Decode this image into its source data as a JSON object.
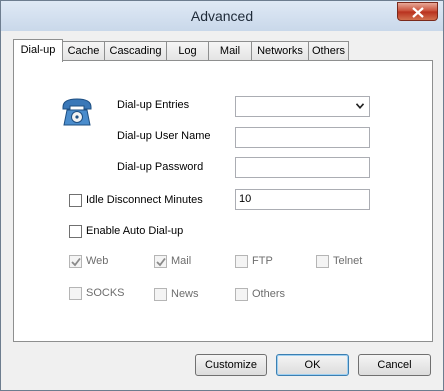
{
  "window": {
    "title": "Advanced"
  },
  "tabs": [
    {
      "label": "Dial-up",
      "active": true
    },
    {
      "label": "Cache",
      "active": false
    },
    {
      "label": "Cascading",
      "active": false
    },
    {
      "label": "Log",
      "active": false
    },
    {
      "label": "Mail",
      "active": false
    },
    {
      "label": "Networks",
      "active": false
    },
    {
      "label": "Others",
      "active": false
    }
  ],
  "form": {
    "phone_icon": "telephone-icon",
    "dialup_entries_label": "Dial-up Entries",
    "dialup_entries_value": "",
    "user_name_label": "Dial-up User Name",
    "user_name_value": "",
    "password_label": "Dial-up Password",
    "password_value": "",
    "idle_disconnect_label": "Idle Disconnect Minutes",
    "idle_disconnect_checked": false,
    "idle_disconnect_value": "10",
    "auto_dialup_label": "Enable Auto Dial-up",
    "auto_dialup_checked": false
  },
  "protocols": [
    {
      "label": "Web",
      "checked": true,
      "enabled": false
    },
    {
      "label": "Mail",
      "checked": true,
      "enabled": false
    },
    {
      "label": "FTP",
      "checked": false,
      "enabled": false
    },
    {
      "label": "Telnet",
      "checked": false,
      "enabled": false
    },
    {
      "label": "SOCKS",
      "checked": false,
      "enabled": false
    },
    {
      "label": "News",
      "checked": false,
      "enabled": false
    },
    {
      "label": "Others",
      "checked": false,
      "enabled": false
    }
  ],
  "buttons": {
    "customize": "Customize",
    "ok": "OK",
    "cancel": "Cancel"
  },
  "colors": {
    "close_button": "#c74a33",
    "phone_icon": "#3a78b8"
  }
}
